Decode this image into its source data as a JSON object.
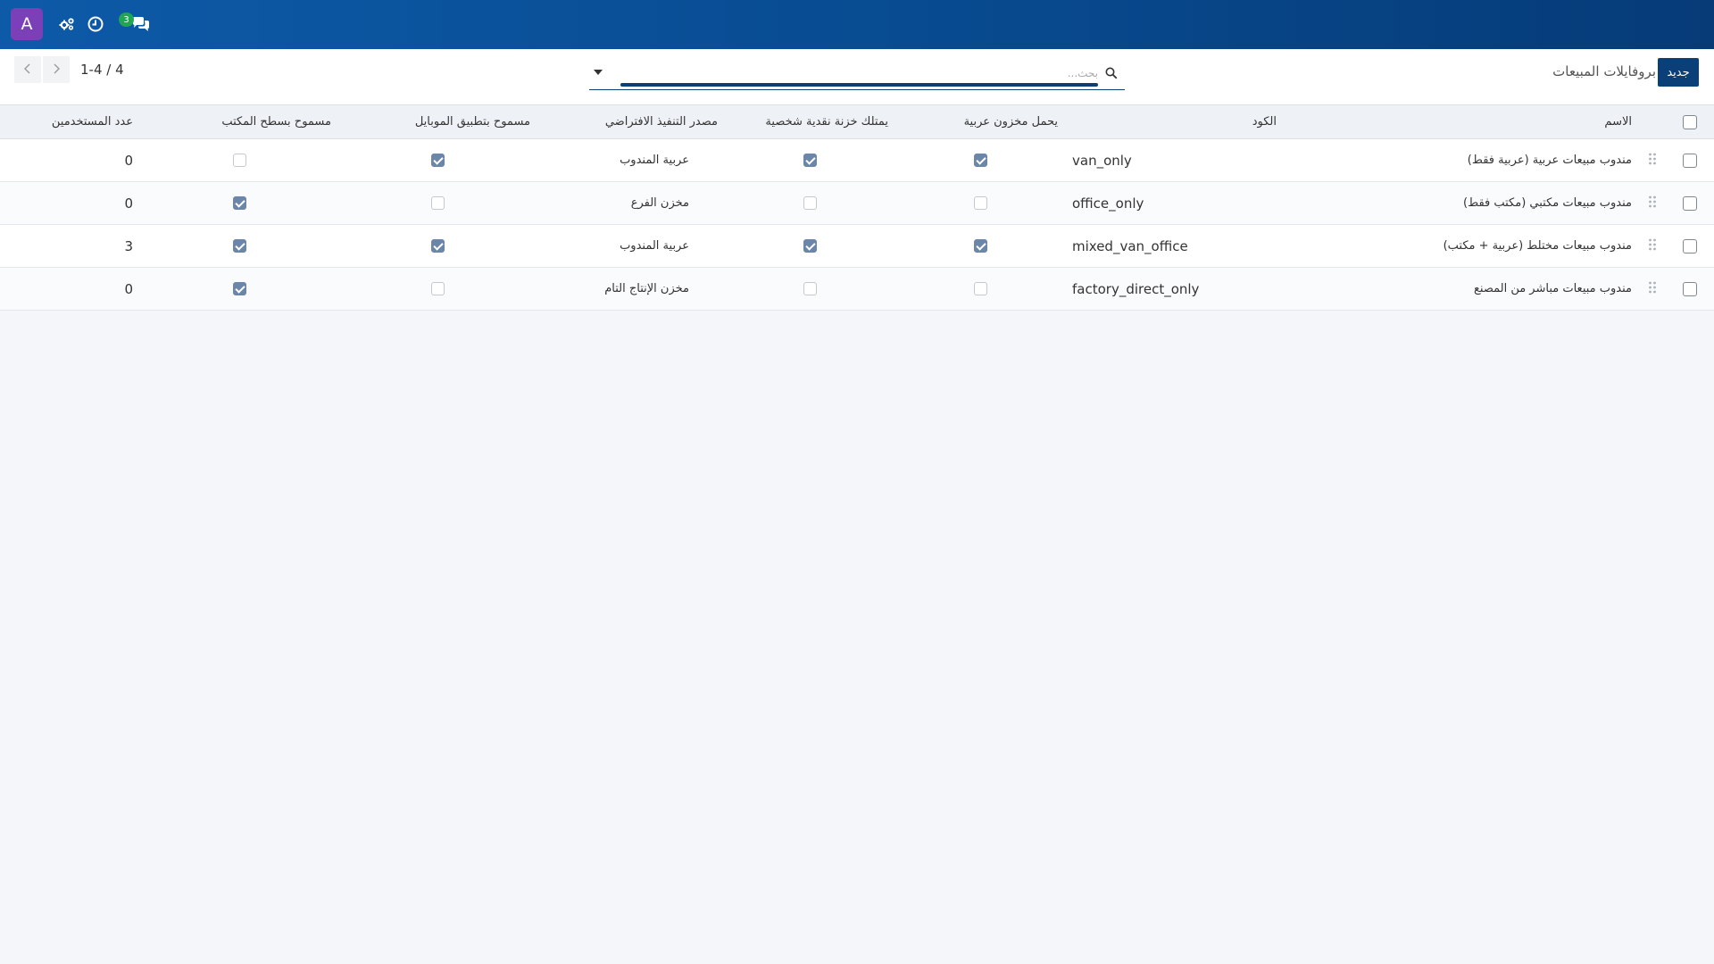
{
  "topbar": {
    "avatar_letter": "A",
    "chat_badge_count": "3",
    "icons": [
      "settings-cogs-icon",
      "clock-icon",
      "chat-icon"
    ]
  },
  "controlbar": {
    "new_label": "جديد",
    "title": "بروفايلات المبيعات",
    "search_placeholder": "بحث...",
    "pager_text": "1-4 / 4"
  },
  "table": {
    "columns": {
      "name": "الاسم",
      "code": "الكود",
      "carries_van_stock": "يحمل مخزون عربية",
      "has_personal_cash": "يمتلك خزنة نقدية شخصية",
      "default_source": "مصدر التنفيذ الافتراضي",
      "mobile_allowed": "مسموح بتطبيق الموبايل",
      "desktop_allowed": "مسموح بسطح المكتب",
      "users_count": "عدد المستخدمين"
    },
    "rows": [
      {
        "name": "مندوب مبيعات عربية (عربية فقط)",
        "code": "van_only",
        "carries_van_stock": true,
        "has_personal_cash": true,
        "default_source": "عربية المندوب",
        "mobile_allowed": true,
        "desktop_allowed": false,
        "users_count": "0"
      },
      {
        "name": "مندوب مبيعات مكتبي (مكتب فقط)",
        "code": "office_only",
        "carries_van_stock": false,
        "has_personal_cash": false,
        "default_source": "مخزن الفرع",
        "mobile_allowed": false,
        "desktop_allowed": true,
        "users_count": "0"
      },
      {
        "name": "مندوب مبيعات مختلط (عربية + مكتب)",
        "code": "mixed_van_office",
        "carries_van_stock": true,
        "has_personal_cash": true,
        "default_source": "عربية المندوب",
        "mobile_allowed": true,
        "desktop_allowed": true,
        "users_count": "3"
      },
      {
        "name": "مندوب مبيعات مباشر من المصنع",
        "code": "factory_direct_only",
        "carries_van_stock": false,
        "has_personal_cash": false,
        "default_source": "مخزن الإنتاج التام",
        "mobile_allowed": false,
        "desktop_allowed": true,
        "users_count": "0"
      }
    ]
  },
  "colors": {
    "topbar_start": "#0d5aa8",
    "topbar_end": "#063b78",
    "primary": "#0b3f78",
    "avatar": "#7b3fb7",
    "badge": "#23a455",
    "checkbox_checked": "#6b86a8"
  }
}
